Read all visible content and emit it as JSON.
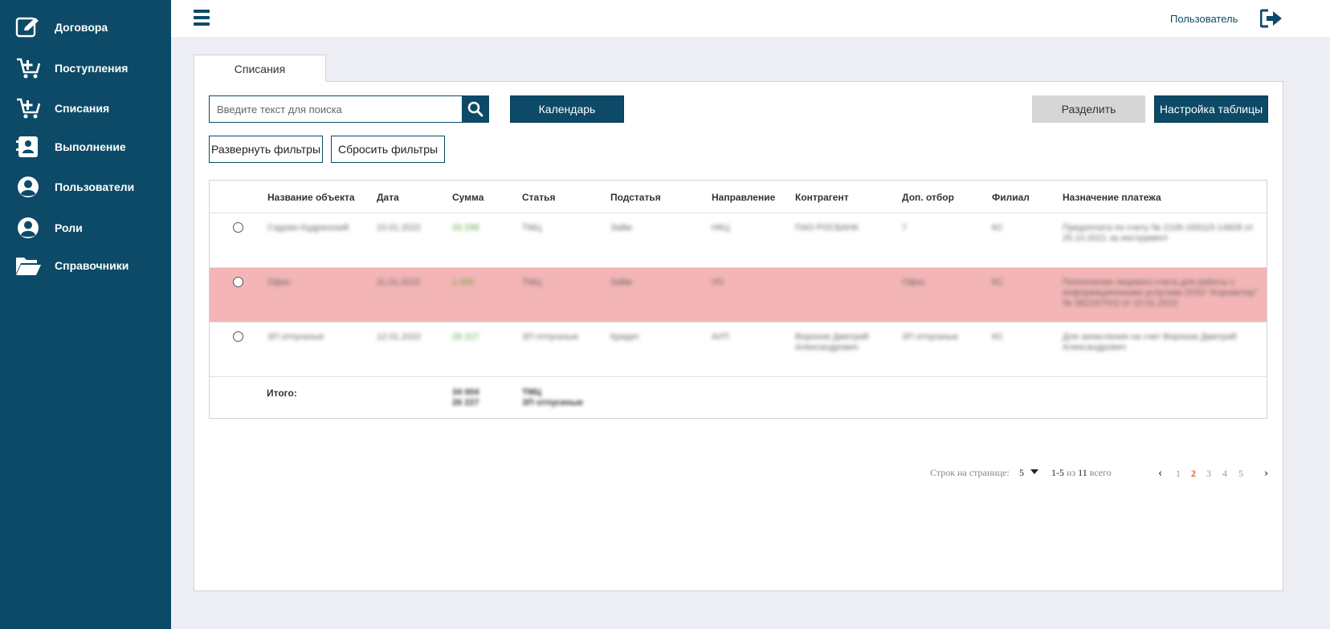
{
  "sidebar": {
    "items": [
      {
        "label": "Договора",
        "icon": "contract-edit-icon"
      },
      {
        "label": "Поступления",
        "icon": "cart-plus-icon"
      },
      {
        "label": "Списания",
        "icon": "cart-plus-icon"
      },
      {
        "label": "Выполнение",
        "icon": "contact-book-icon"
      },
      {
        "label": "Пользователи",
        "icon": "user-circle-icon"
      },
      {
        "label": "Роли",
        "icon": "user-circle-icon"
      },
      {
        "label": "Справочники",
        "icon": "folder-open-icon"
      }
    ]
  },
  "header": {
    "user_label": "Пользователь",
    "logout_icon": "sign-out-icon"
  },
  "tab": {
    "label": "Списания"
  },
  "toolbar": {
    "search_placeholder": "Введите текст для поиска",
    "calendar_label": "Календарь",
    "split_label": "Разделить",
    "table_settings_label": "Настройка таблицы",
    "expand_filters_label": "Развернуть фильтры",
    "reset_filters_label": "Сбросить фильтры"
  },
  "table": {
    "columns": [
      "Название объекта",
      "Дата",
      "Сумма",
      "Статья",
      "Подстатья",
      "Направление",
      "Контрагент",
      "Доп. отбор",
      "Филиал",
      "Назначение платежа"
    ],
    "rows": [
      {
        "highlight": false,
        "cells": [
          "Садово-Кудринский",
          "10.01.2022",
          "33 298",
          "ТМЦ",
          "Займ",
          "НКЦ",
          "ПАО РОСБАНК",
          "7",
          "КС",
          "Предоплата по счету № 2106-169115-14608 от 25.10.2021 за инструмент"
        ]
      },
      {
        "highlight": true,
        "cells": [
          "Офис",
          "11.01.2022",
          "1 000",
          "ТМЦ",
          "Займ",
          "УО",
          "",
          "Офис",
          "КС",
          "Пополнение лицевого счета для работы с информационными услугами ООО \"Аэроветер\" № 382247/VI2 от 10.01.2022"
        ]
      },
      {
        "highlight": false,
        "cells": [
          "ЗП отпускные",
          "12.01.2022",
          "26 227",
          "ЗП отпускные",
          "Кредит",
          "АУП",
          "Воронов Дмитрий Александрович",
          "ЗП отпускные",
          "КС",
          "Для зачисления на счет Воронов Дмитрий Александрович"
        ]
      }
    ],
    "totals": {
      "label": "Итого:",
      "sum": "34 004\n26 227",
      "article": "ТМЦ\nЗП отпускные"
    }
  },
  "pagination": {
    "rows_per_page_label": "Строк на странице:",
    "rows_per_page_value": "5",
    "range_start": "1-5",
    "range_of": "из",
    "total": "11",
    "total_suffix": "всего",
    "pages": [
      "1",
      "2",
      "3",
      "4",
      "5"
    ],
    "current_page": "2"
  },
  "colors": {
    "brand": "#0c4a68",
    "highlight_row": "#f3b5b6",
    "active_page": "#e05a1a",
    "sum_green": "#5aa83a"
  }
}
